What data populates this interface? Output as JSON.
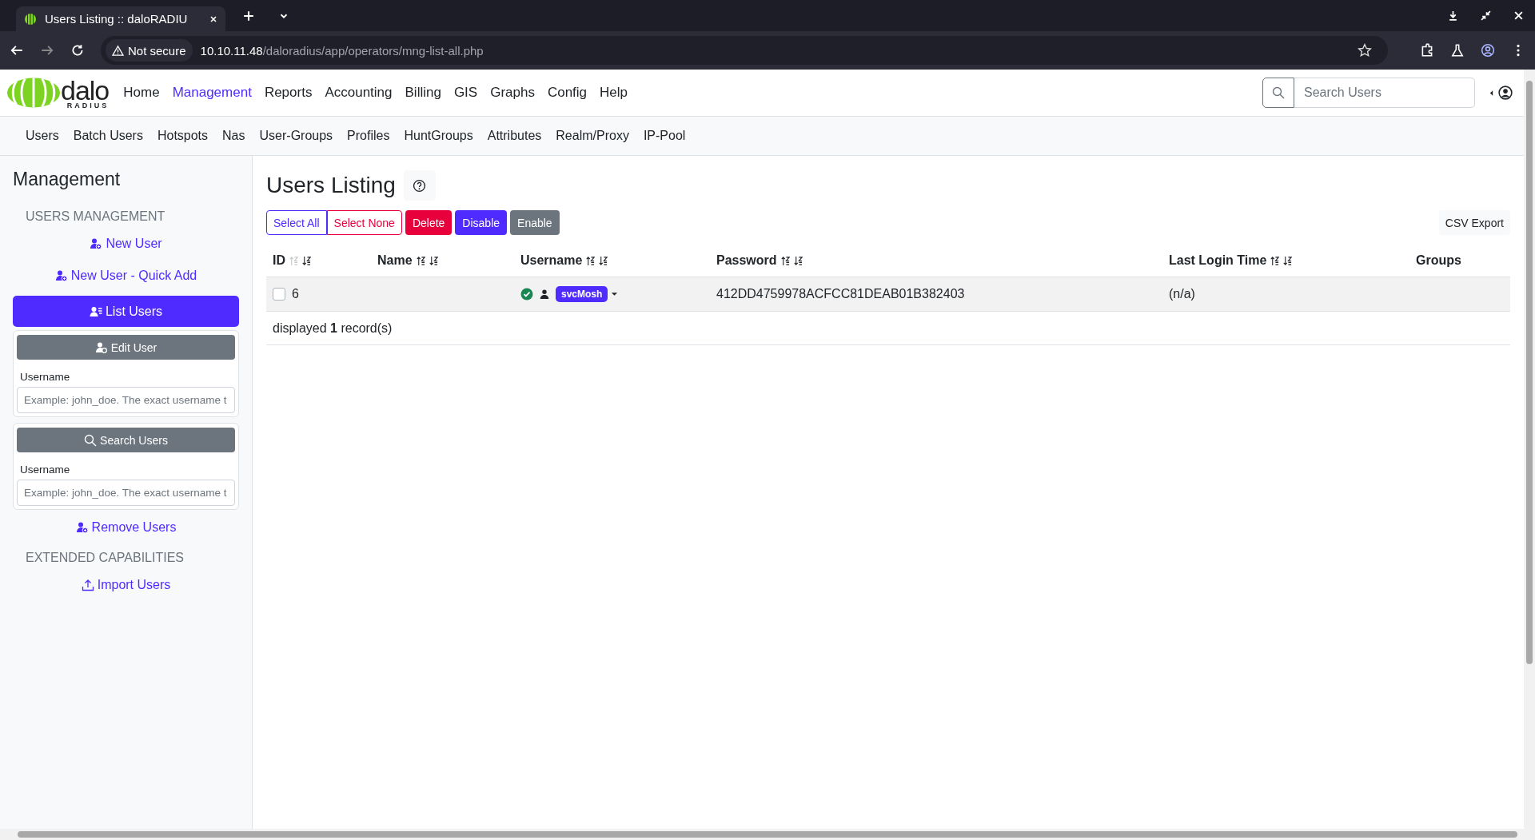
{
  "browser": {
    "tab_title": "Users Listing :: daloRADIU",
    "security": "Not secure",
    "url_host": "10.10.11.48",
    "url_path": "/daloradius/app/operators/mng-list-all.php"
  },
  "logo": {
    "word": "dalo",
    "sub": "RADIUS"
  },
  "main_nav": [
    {
      "label": "Home",
      "selected": false
    },
    {
      "label": "Management",
      "selected": true
    },
    {
      "label": "Reports",
      "selected": false
    },
    {
      "label": "Accounting",
      "selected": false
    },
    {
      "label": "Billing",
      "selected": false
    },
    {
      "label": "GIS",
      "selected": false
    },
    {
      "label": "Graphs",
      "selected": false
    },
    {
      "label": "Config",
      "selected": false
    },
    {
      "label": "Help",
      "selected": false
    }
  ],
  "search": {
    "placeholder": "Search Users"
  },
  "sub_nav": [
    "Users",
    "Batch Users",
    "Hotspots",
    "Nas",
    "User-Groups",
    "Profiles",
    "HuntGroups",
    "Attributes",
    "Realm/Proxy",
    "IP-Pool"
  ],
  "sidebar": {
    "title": "Management",
    "sections": [
      {
        "heading": "USERS MANAGEMENT",
        "items": [
          {
            "kind": "link",
            "label": "New User"
          },
          {
            "kind": "link",
            "label": "New User - Quick Add"
          },
          {
            "kind": "current",
            "label": "List Users"
          },
          {
            "kind": "edit-form",
            "label": "Edit User",
            "field_label": "Username",
            "placeholder": "Example: john_doe. The exact username t"
          },
          {
            "kind": "search-form",
            "label": "Search Users",
            "field_label": "Username",
            "placeholder": "Example: john_doe. The exact username t"
          },
          {
            "kind": "link",
            "label": "Remove Users"
          }
        ]
      },
      {
        "heading": "EXTENDED CAPABILITIES",
        "items": [
          {
            "kind": "import",
            "label": "Import Users"
          }
        ]
      }
    ]
  },
  "content": {
    "title": "Users Listing",
    "actions": [
      {
        "label": "Select All",
        "kind": "outline-primary"
      },
      {
        "label": "Select None",
        "kind": "outline-danger"
      },
      {
        "label": "Delete",
        "kind": "danger"
      },
      {
        "label": "Disable",
        "kind": "primary"
      },
      {
        "label": "Enable",
        "kind": "secondary"
      }
    ],
    "export": "CSV Export",
    "table": {
      "columns": [
        {
          "label": "ID",
          "kind": "sortable",
          "asc_dimmed": true
        },
        {
          "label": "Name",
          "kind": "sortable",
          "asc_dimmed": false
        },
        {
          "label": "Username",
          "kind": "sortable",
          "asc_dimmed": false
        },
        {
          "label": "Password",
          "kind": "sortable",
          "asc_dimmed": false
        },
        {
          "label": "Last Login Time",
          "kind": "sortable",
          "asc_dimmed": false
        },
        {
          "label": "Groups",
          "kind": "plain"
        }
      ],
      "rows": [
        {
          "checked": false,
          "id": "6",
          "enabled": true,
          "username": "svcMosh",
          "password": "412DD4759978ACFCC81DEAB01B382403",
          "last_login": "(n/a)"
        }
      ],
      "footer": "displayed **1** record(s)"
    }
  }
}
